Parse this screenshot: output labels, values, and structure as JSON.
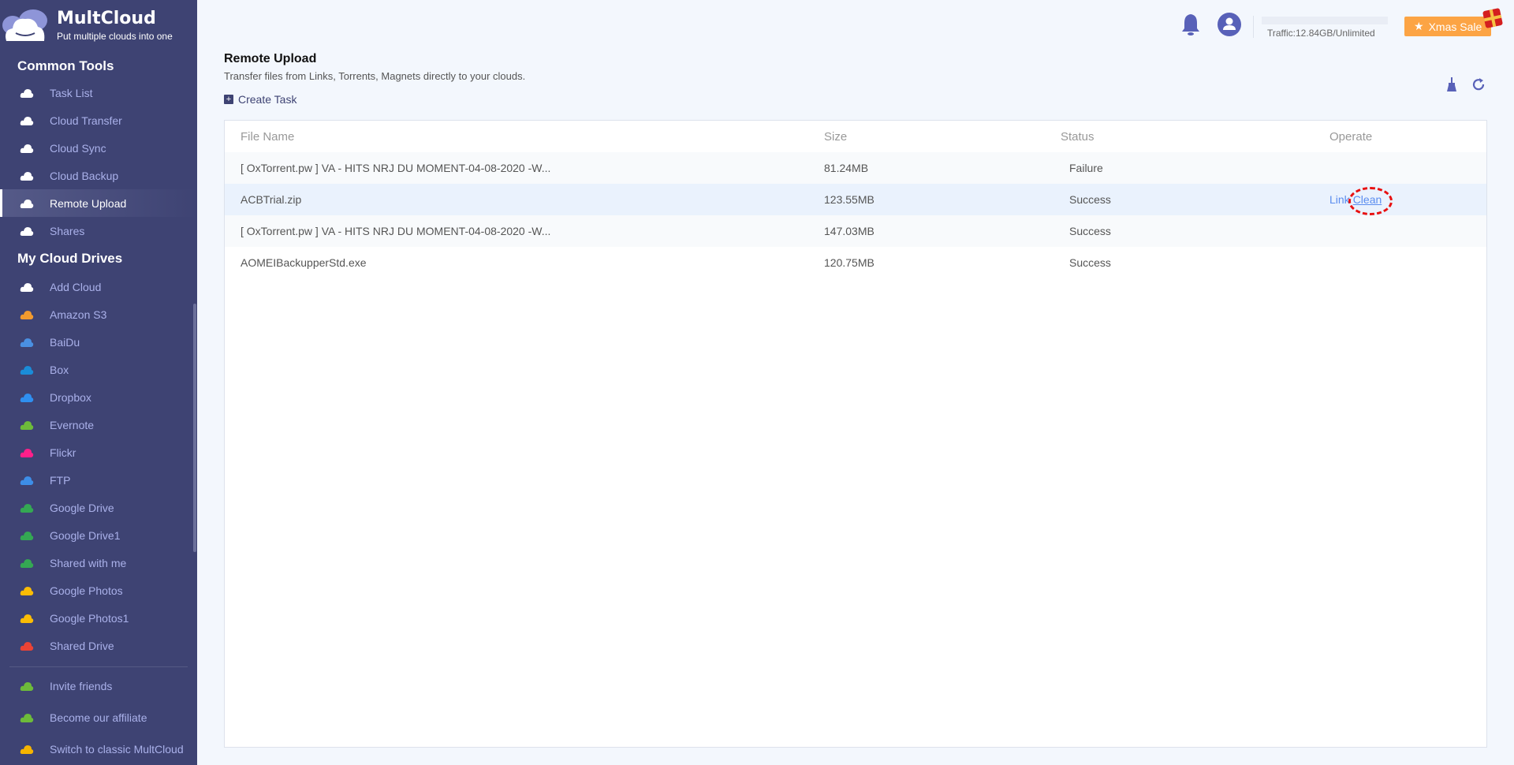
{
  "brand": {
    "name": "MultCloud",
    "tagline": "Put multiple clouds into one"
  },
  "sidebar": {
    "common_tools_label": "Common Tools",
    "common_tools": [
      {
        "label": "Task List",
        "icon": "clipboard-icon"
      },
      {
        "label": "Cloud Transfer",
        "icon": "cloud-transfer-icon"
      },
      {
        "label": "Cloud Sync",
        "icon": "cloud-sync-icon"
      },
      {
        "label": "Cloud Backup",
        "icon": "cloud-backup-icon"
      },
      {
        "label": "Remote Upload",
        "icon": "cloud-upload-icon",
        "active": true
      },
      {
        "label": "Shares",
        "icon": "share-icon"
      }
    ],
    "my_drives_label": "My Cloud Drives",
    "drives": [
      {
        "label": "Add Cloud",
        "icon": "add-cloud-icon",
        "color": "#ffffff"
      },
      {
        "label": "Amazon S3",
        "icon": "amazon-s3-icon",
        "color": "#f29a2e"
      },
      {
        "label": "BaiDu",
        "icon": "baidu-icon",
        "color": "#4a90e2"
      },
      {
        "label": "Box",
        "icon": "box-icon",
        "color": "#1a8cd8"
      },
      {
        "label": "Dropbox",
        "icon": "dropbox-icon",
        "color": "#2f8ff0"
      },
      {
        "label": "Evernote",
        "icon": "evernote-icon",
        "color": "#6dbb3a"
      },
      {
        "label": "Flickr",
        "icon": "flickr-icon",
        "color": "#ff1f8a"
      },
      {
        "label": "FTP",
        "icon": "ftp-icon",
        "color": "#3d8ee8"
      },
      {
        "label": "Google Drive",
        "icon": "google-drive-icon",
        "color": "#34a853"
      },
      {
        "label": "Google Drive1",
        "icon": "google-drive-icon",
        "color": "#34a853"
      },
      {
        "label": "Shared with me",
        "icon": "google-drive-icon",
        "color": "#34a853"
      },
      {
        "label": "Google Photos",
        "icon": "google-photos-icon",
        "color": "#fbbc05"
      },
      {
        "label": "Google Photos1",
        "icon": "google-photos-icon",
        "color": "#fbbc05"
      },
      {
        "label": "Shared Drive",
        "icon": "google-icon",
        "color": "#ea4335"
      }
    ],
    "bottom": [
      {
        "label": "Invite friends",
        "icon": "trophy-icon",
        "color": "#6dbb3a"
      },
      {
        "label": "Become our affiliate",
        "icon": "dollar-icon",
        "color": "#6dbb3a"
      },
      {
        "label": "Switch to classic MultCloud",
        "icon": "switch-icon",
        "color": "#f5b400"
      }
    ]
  },
  "topbar": {
    "traffic": "Traffic:12.84GB/Unlimited",
    "sale": "Xmas Sale"
  },
  "page": {
    "title": "Remote Upload",
    "subtitle": "Transfer files from Links, Torrents, Magnets directly to your clouds.",
    "create_task": "Create Task"
  },
  "table": {
    "headers": [
      "File Name",
      "Size",
      "Status",
      "Operate"
    ],
    "rows": [
      {
        "name": "[ OxTorrent.pw ] VA - HITS NRJ DU MOMENT-04-08-2020 -W...",
        "size": "81.24MB",
        "status": "Failure"
      },
      {
        "name": "ACBTrial.zip",
        "size": "123.55MB",
        "status": "Success",
        "ops": [
          "Link",
          "Clean"
        ]
      },
      {
        "name": "[ OxTorrent.pw ] VA - HITS NRJ DU MOMENT-04-08-2020 -W...",
        "size": "147.03MB",
        "status": "Success"
      },
      {
        "name": "AOMEIBackupperStd.exe",
        "size": "120.75MB",
        "status": "Success"
      }
    ]
  },
  "colors": {
    "sidebar": "#3e4373",
    "accent": "#5861b8",
    "link": "#5b8def",
    "sale": "#fca444"
  }
}
